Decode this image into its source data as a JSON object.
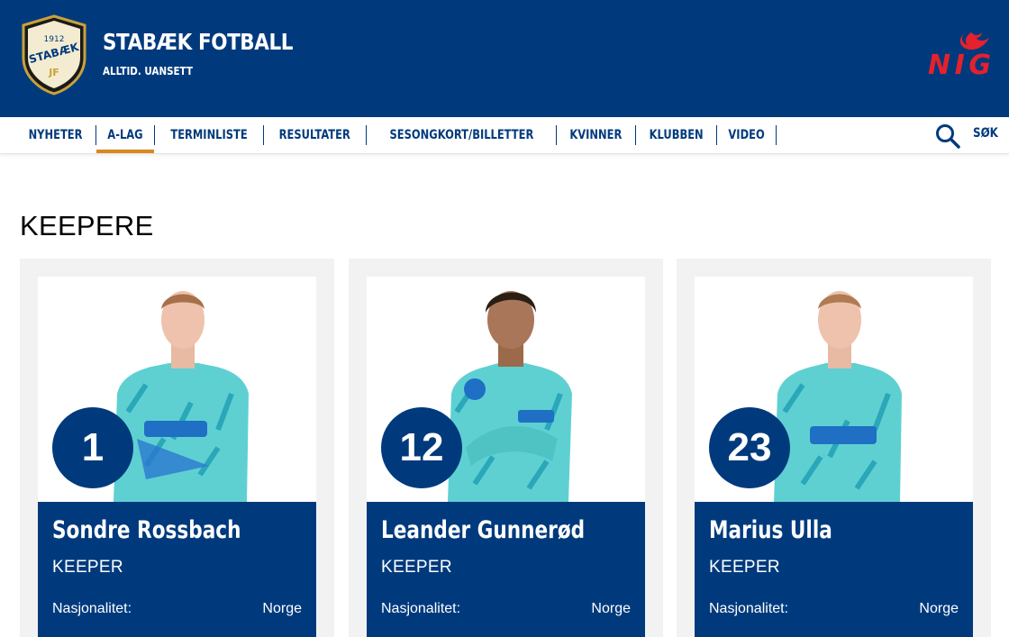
{
  "header": {
    "title": "STABÆK FOTBALL",
    "subtitle": "ALLTID. UANSETT",
    "logo_text_top": "1912",
    "logo_text_mid": "STABÆK",
    "logo_text_bottom": "JF",
    "sponsor": "NIG",
    "colors": {
      "primary": "#003a7d",
      "accent": "#d98a1f",
      "sponsor_red": "#e4212d"
    }
  },
  "nav": {
    "items": [
      {
        "label": "NYHETER"
      },
      {
        "label": "A-LAG",
        "active": true
      },
      {
        "label": "TERMINLISTE"
      },
      {
        "label": "RESULTATER"
      },
      {
        "label": "SESONGKORT/BILLETTER"
      },
      {
        "label": "KVINNER"
      },
      {
        "label": "KLUBBEN"
      },
      {
        "label": "VIDEO"
      }
    ],
    "search_label": "SØK",
    "search_icon": "search-icon"
  },
  "section": {
    "title": "KEEPERE"
  },
  "players": [
    {
      "number": "1",
      "name": "Sondre Rossbach",
      "position": "KEEPER",
      "nationality_label": "Nasjonalitet:",
      "nationality": "Norge"
    },
    {
      "number": "12",
      "name": "Leander Gunnerød",
      "position": "KEEPER",
      "nationality_label": "Nasjonalitet:",
      "nationality": "Norge"
    },
    {
      "number": "23",
      "name": "Marius Ulla",
      "position": "KEEPER",
      "nationality_label": "Nasjonalitet:",
      "nationality": "Norge"
    }
  ]
}
